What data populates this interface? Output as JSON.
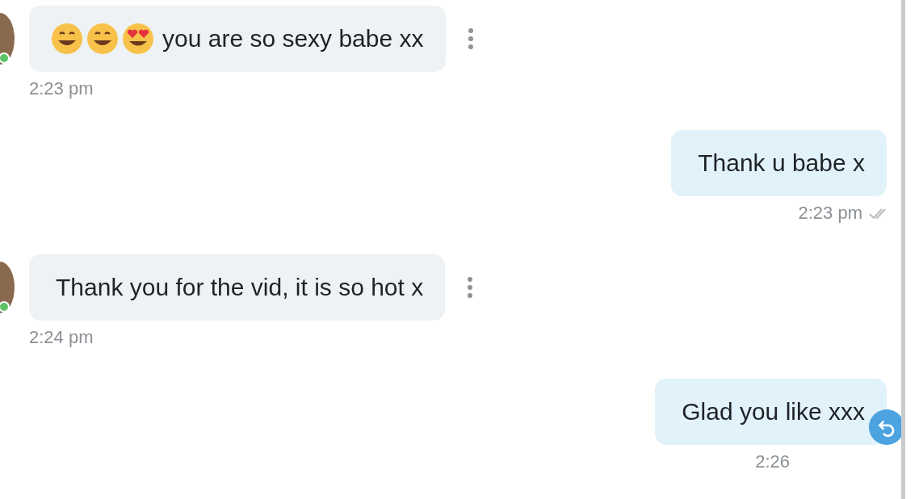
{
  "messages": [
    {
      "kind": "incoming",
      "online": true,
      "emoji": [
        {
          "kind": "grin"
        },
        {
          "kind": "grin"
        },
        {
          "kind": "heart_eyes"
        }
      ],
      "text": "you are so sexy babe xx",
      "time": "2:23 pm"
    },
    {
      "kind": "outgoing",
      "read": true,
      "text": "Thank u babe x",
      "time": "2:23 pm"
    },
    {
      "kind": "incoming",
      "online": true,
      "text": "Thank you for the vid, it is so hot x",
      "time": "2:24 pm"
    },
    {
      "kind": "outgoing",
      "reply_button": true,
      "text": "Glad you like xxx",
      "time": "2:26"
    }
  ]
}
